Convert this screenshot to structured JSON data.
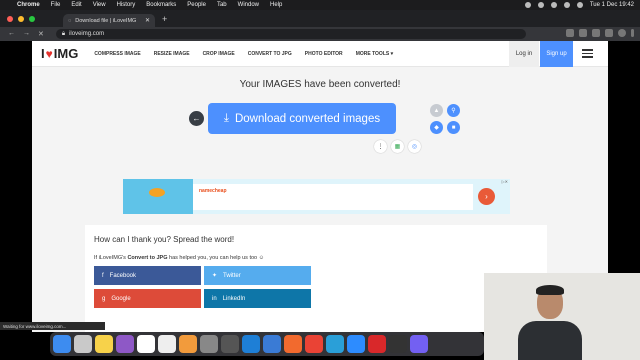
{
  "menubar": {
    "apple": "",
    "items": [
      "Chrome",
      "File",
      "Edit",
      "View",
      "History",
      "Bookmarks",
      "People",
      "Tab",
      "Window",
      "Help"
    ],
    "clock": "Tue 1 Dec 19:42"
  },
  "browser": {
    "tab_title": "Download file | iLoveIMG",
    "tab_close": "✕",
    "new_tab": "+",
    "url": "iloveimg.com",
    "back": "←",
    "forward": "→",
    "reload": "✕",
    "status": "Waiting for www.iloveimg.com..."
  },
  "site": {
    "logo_i": "I",
    "logo_heart": "♥",
    "logo_img": "IMG",
    "nav": [
      "COMPRESS IMAGE",
      "RESIZE IMAGE",
      "CROP IMAGE",
      "CONVERT TO JPG",
      "PHOTO EDITOR",
      "MORE TOOLS ▾"
    ],
    "login": "Log in",
    "signup": "Sign up"
  },
  "result": {
    "heading": "Your IMAGES have been converted!",
    "back_icon": "←",
    "download_icon": "⤓",
    "download_label": "Download converted images"
  },
  "ad": {
    "brand": "namecheap",
    "arrow": "›",
    "tag": "▷✕"
  },
  "thanks": {
    "title": "How can I thank you? Spread the word!",
    "helped_prefix": "If iLoveIMG's ",
    "helped_bold": "Convert to JPG",
    "helped_suffix": " has helped you, you can help us too ☺",
    "facebook": "Facebook",
    "twitter": "Twitter",
    "google": "Google",
    "linkedin": "LinkedIn"
  },
  "colors": {
    "accent": "#4d90fe",
    "brand_red": "#e5322d",
    "facebook": "#3b5998",
    "twitter": "#55acee",
    "google": "#dd4b39",
    "linkedin": "#0e76a8"
  },
  "icons": {
    "drive": "▲",
    "link": "⚲",
    "dropbox": "◆",
    "trash": "■",
    "more": "⋮",
    "sheet": "▦",
    "satellite": "◎"
  }
}
